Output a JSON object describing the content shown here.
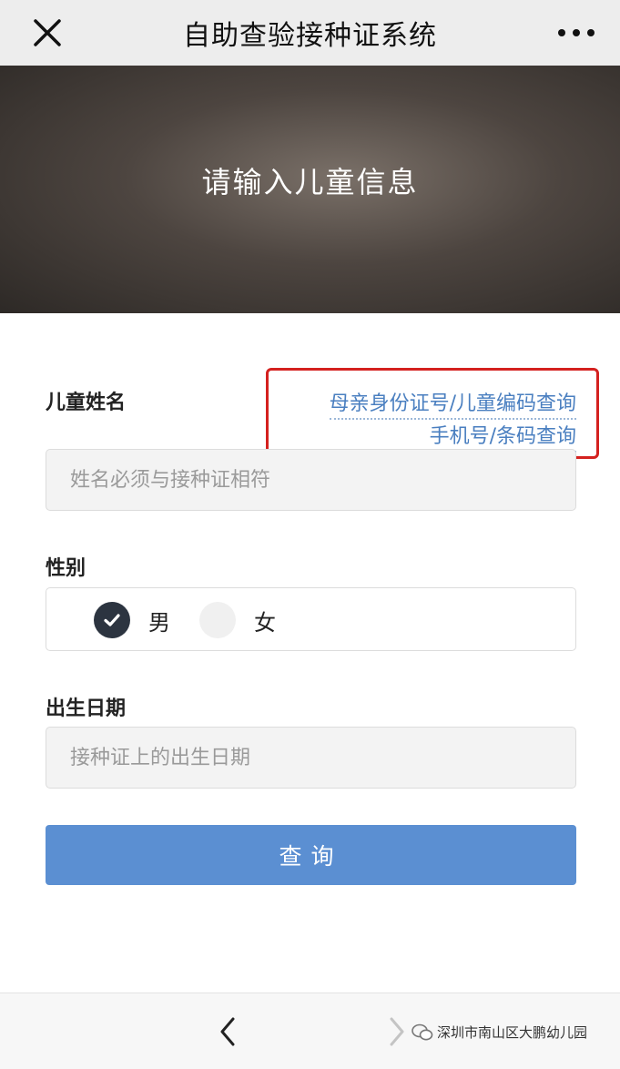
{
  "header": {
    "title": "自助查验接种证系统",
    "close_icon": "close-icon",
    "more_icon": "more-icon"
  },
  "banner": {
    "text": "请输入儿童信息"
  },
  "form": {
    "name_label": "儿童姓名",
    "links": {
      "id_code_query": "母亲身份证号/儿童编码查询",
      "phone_barcode_query": "手机号/条码查询"
    },
    "name_placeholder": "姓名必须与接种证相符",
    "gender_label": "性别",
    "gender_options": [
      {
        "label": "男",
        "selected": true
      },
      {
        "label": "女",
        "selected": false
      }
    ],
    "birth_label": "出生日期",
    "birth_placeholder": "接种证上的出生日期",
    "submit_label": "查询"
  },
  "footer": {
    "back_icon": "chevron-left-icon",
    "forward_icon": "chevron-right-icon",
    "source": "深圳市南山区大鹏幼儿园"
  },
  "colors": {
    "accent": "#5b8fd2",
    "link": "#4a7fc0",
    "highlight_box": "#d4211f"
  }
}
